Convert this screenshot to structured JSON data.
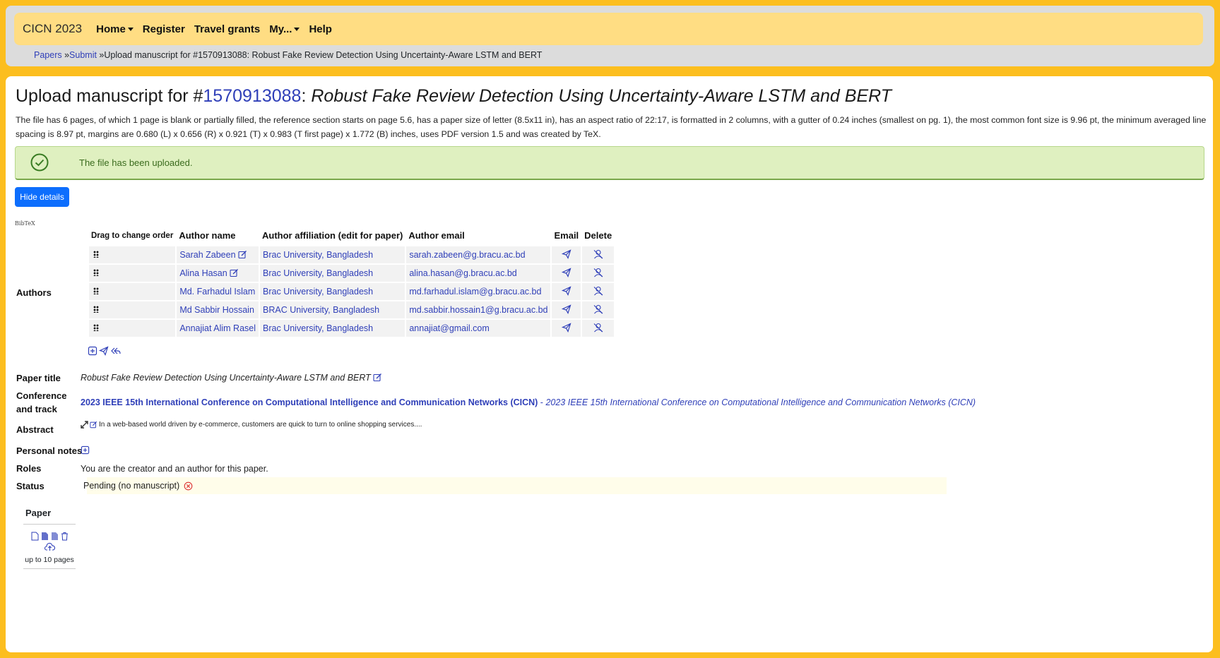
{
  "navbar": {
    "brand": "CICN 2023",
    "items": [
      {
        "label": "Home",
        "dropdown": true
      },
      {
        "label": "Register",
        "dropdown": false
      },
      {
        "label": "Travel grants",
        "dropdown": false
      },
      {
        "label": "My...",
        "dropdown": true
      },
      {
        "label": "Help",
        "dropdown": false
      }
    ]
  },
  "breadcrumb": {
    "papers": "Papers",
    "submit": "Submit",
    "current": "Upload manuscript for #1570913088: Robust Fake Review Detection Using Uncertainty-Aware LSTM and BERT"
  },
  "page": {
    "title_prefix": "Upload manuscript for #",
    "paper_id": "1570913088",
    "title_sep": ": ",
    "paper_title": "Robust Fake Review Detection Using Uncertainty-Aware LSTM and BERT",
    "file_info": "The file has 6 pages, of which 1 page is blank or partially filled, the reference section starts on page 5.6, has a paper size of letter (8.5x11 in), has an aspect ratio of 22:17, is formatted in 2 columns, with a gutter of 0.24 inches (smallest on pg. 1), the most common font size is 9.96 pt, the minimum averaged line spacing is 8.97 pt, margins are 0.680 (L) x 0.656 (R) x 0.921 (T) x 0.983 (T first page) x 1.772 (B) inches, uses PDF version 1.5 and was created by TeX.",
    "alert": "The file has been uploaded.",
    "hide_details": "Hide details",
    "bibtex": "BibTeX"
  },
  "authors": {
    "label": "Authors",
    "headers": {
      "drag": "Drag to change order",
      "name": "Author name",
      "affiliation": "Author affiliation (edit for paper)",
      "email": "Author email",
      "email_action": "Email",
      "delete": "Delete"
    },
    "rows": [
      {
        "name": "Sarah Zabeen",
        "edit": true,
        "affiliation": "Brac University, Bangladesh",
        "email": "sarah.zabeen@g.bracu.ac.bd"
      },
      {
        "name": "Alina Hasan",
        "edit": true,
        "affiliation": "Brac University, Bangladesh",
        "email": "alina.hasan@g.bracu.ac.bd"
      },
      {
        "name": "Md. Farhadul Islam",
        "edit": false,
        "affiliation": "Brac University, Bangladesh",
        "email": "md.farhadul.islam@g.bracu.ac.bd"
      },
      {
        "name": "Md Sabbir Hossain",
        "edit": false,
        "affiliation": "BRAC University, Bangladesh",
        "email": "md.sabbir.hossain1@g.bracu.ac.bd"
      },
      {
        "name": "Annajiat Alim Rasel",
        "edit": false,
        "affiliation": "Brac University, Bangladesh",
        "email": "annajiat@gmail.com"
      }
    ]
  },
  "details": {
    "paper_title_label": "Paper title",
    "paper_title": "Robust Fake Review Detection Using Uncertainty-Aware LSTM and BERT",
    "conference_label_1": "Conference",
    "conference_label_2": "and track",
    "conference_name": "2023 IEEE 15th International Conference on Computational Intelligence and Communication Networks (CICN)",
    "track_sep": " - ",
    "track_name": "2023 IEEE 15th International Conference on Computational Intelligence and Communication Networks (CICN)",
    "abstract_label": "Abstract",
    "abstract": "In a web-based world driven by e-commerce, customers are quick to turn to online shopping services....",
    "notes_label": "Personal notes",
    "roles_label": "Roles",
    "roles": "You are the creator and an author for this paper.",
    "status_label": "Status",
    "status": "Pending (no manuscript)"
  },
  "paper": {
    "label": "Paper",
    "limit": "up to 10 pages"
  },
  "colors": {
    "page_bg": "#fcbe1f",
    "navbar_bg": "#ffdd83",
    "link": "#2f3fb8",
    "success_bg": "#dff0c0",
    "primary": "#0d6efd"
  }
}
